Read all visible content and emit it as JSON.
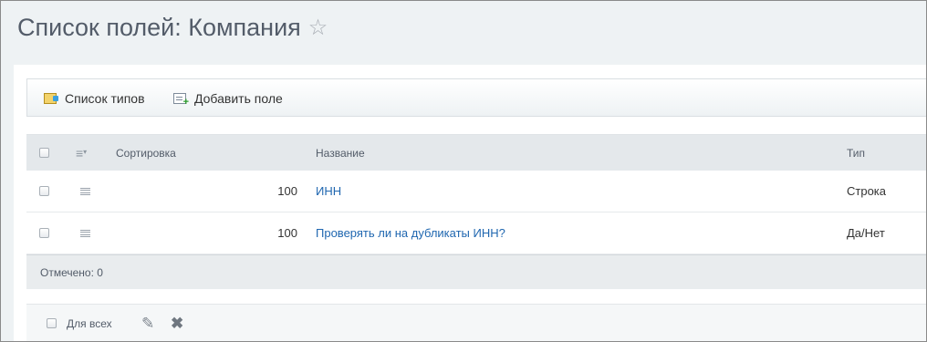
{
  "page": {
    "title": "Список полей: Компания",
    "favorite_icon": "star-icon"
  },
  "toolbar": {
    "types_label": "Список типов",
    "types_icon": "list-types-icon",
    "add_label": "Добавить поле",
    "add_icon": "add-field-icon"
  },
  "grid": {
    "columns": {
      "sort": "Сортировка",
      "name": "Название",
      "type": "Тип"
    },
    "rows": [
      {
        "sort": "100",
        "name": "ИНН",
        "type": "Строка"
      },
      {
        "sort": "100",
        "name": "Проверять ли на дубликаты ИНН?",
        "type": "Да/Нет"
      }
    ],
    "footer": "Отмечено: 0"
  },
  "actions": {
    "for_all_label": "Для всех",
    "edit_icon": "pencil-icon",
    "delete_icon": "delete-icon"
  },
  "colors": {
    "link": "#2067b0",
    "title": "#535c69",
    "background": "#eef2f4"
  }
}
